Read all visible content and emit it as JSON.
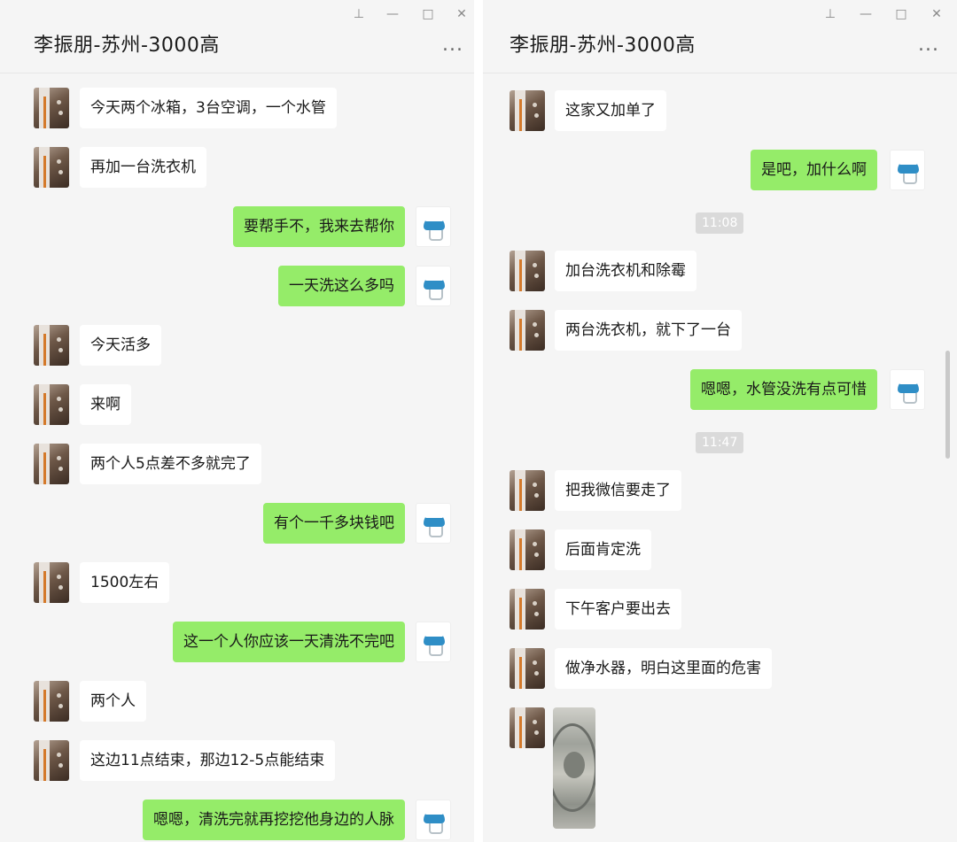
{
  "left": {
    "title": "李振朋-苏州-3000高",
    "window_controls": [
      "pin-icon",
      "minimize-icon",
      "maximize-icon",
      "close-icon"
    ],
    "more": "...",
    "messages": [
      {
        "side": "l",
        "text": "今天两个冰箱，3台空调，一个水管"
      },
      {
        "side": "l",
        "text": "再加一台洗衣机"
      },
      {
        "side": "r",
        "text": "要帮手不，我来去帮你"
      },
      {
        "side": "r",
        "text": "一天洗这么多吗"
      },
      {
        "side": "l",
        "text": "今天活多"
      },
      {
        "side": "l",
        "text": "来啊"
      },
      {
        "side": "l",
        "text": "两个人5点差不多就完了"
      },
      {
        "side": "r",
        "text": "有个一千多块钱吧"
      },
      {
        "side": "l",
        "text": "1500左右"
      },
      {
        "side": "r",
        "text": "这一个人你应该一天清洗不完吧"
      },
      {
        "side": "l",
        "text": "两个人"
      },
      {
        "side": "l",
        "text": "这边11点结束，那边12-5点能结束"
      },
      {
        "side": "r",
        "text": "嗯嗯，清洗完就再挖挖他身边的人脉"
      }
    ]
  },
  "right": {
    "title": "李振朋-苏州-3000高",
    "window_controls": [
      "pin-icon",
      "minimize-icon",
      "maximize-icon",
      "close-icon"
    ],
    "more": "...",
    "messages": [
      {
        "side": "l",
        "text": "这家又加单了"
      },
      {
        "side": "r",
        "text": "是吧，加什么啊"
      },
      {
        "type": "time",
        "text": "11:08"
      },
      {
        "side": "l",
        "text": "加台洗衣机和除霉"
      },
      {
        "side": "l",
        "text": "两台洗衣机，就下了一台"
      },
      {
        "side": "r",
        "text": "嗯嗯，水管没洗有点可惜"
      },
      {
        "type": "time",
        "text": "11:47"
      },
      {
        "side": "l",
        "text": "把我微信要走了"
      },
      {
        "side": "l",
        "text": "后面肯定洗"
      },
      {
        "side": "l",
        "text": "下午客户要出去"
      },
      {
        "side": "l",
        "text": "做净水器，明白这里面的危害"
      },
      {
        "side": "l",
        "type": "image",
        "text": ""
      }
    ]
  }
}
